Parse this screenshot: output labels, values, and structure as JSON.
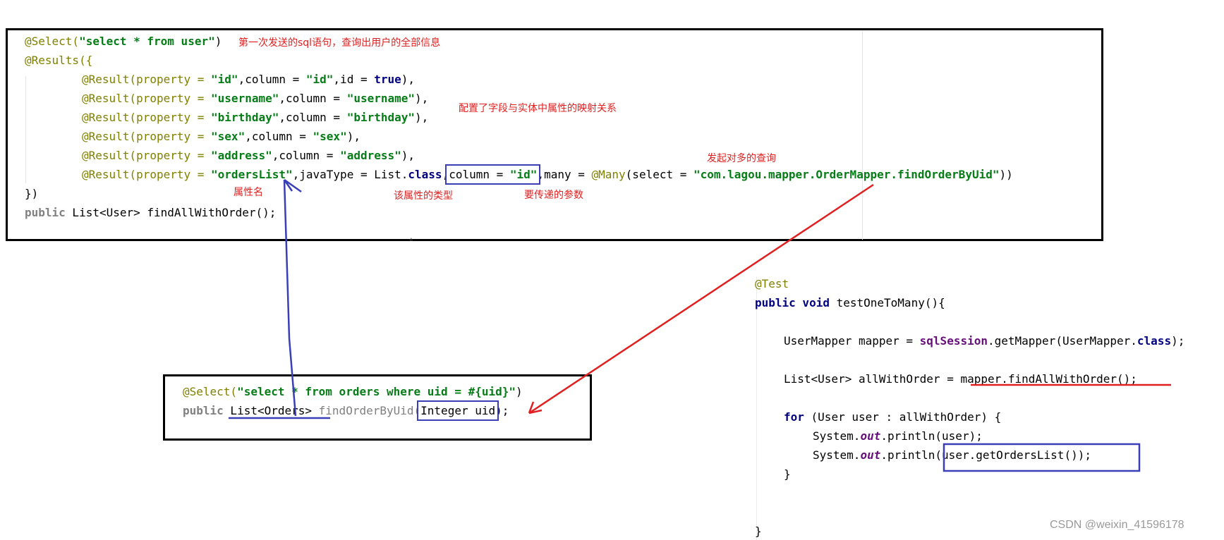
{
  "top_panel": {
    "lines": [
      [
        "@Select(",
        "\"select * from user\"",
        ")"
      ],
      [
        "@Results({"
      ],
      [
        "@Result(property = ",
        "\"id\"",
        ",column = ",
        "\"id\"",
        ",id = ",
        "true",
        "),"
      ],
      [
        "@Result(property = ",
        "\"username\"",
        ",column = ",
        "\"username\"",
        "),"
      ],
      [
        "@Result(property = ",
        "\"birthday\"",
        ",column = ",
        "\"birthday\"",
        "),"
      ],
      [
        "@Result(property = ",
        "\"sex\"",
        ",column = ",
        "\"sex\"",
        "),"
      ],
      [
        "@Result(property = ",
        "\"address\"",
        ",column = ",
        "\"address\"",
        "),"
      ],
      [
        "@Result(property = ",
        "\"ordersList\"",
        ",javaType = List.",
        "class",
        ",",
        "column = ",
        "\"id\"",
        ",many = ",
        "@Many",
        "(select = ",
        "\"com.lagou.mapper.OrderMapper.findOrderByUid\"",
        "))"
      ],
      [
        "})"
      ],
      [
        "public",
        " List<User> findAllWithOrder();"
      ]
    ]
  },
  "notes": {
    "first_sql": "第一次发送的sql语句，查询出用户的全部信息",
    "mapping": "配置了字段与实体中属性的映射关系",
    "one_to_many": "发起对多的查询",
    "property_name": "属性名",
    "property_type": "该属性的类型",
    "param": "要传递的参数"
  },
  "bottom_panel": {
    "lines": [
      [
        "@Select(",
        "\"select * from orders where uid = #{uid}\"",
        ")"
      ],
      [
        "public",
        " List<Orders> ",
        "findOrderByUid(",
        "Integer uid",
        ");"
      ]
    ]
  },
  "test_panel": {
    "lines": [
      [
        "@Test"
      ],
      [
        "public void",
        " testOneToMany(){"
      ],
      [
        "UserMapper mapper = ",
        "sqlSession",
        ".getMapper(UserMapper.",
        "class",
        ");"
      ],
      [
        "List<User> allWithOrder = ",
        "mapper.findAllWithOrder();"
      ],
      [
        "for",
        " (User user : allWithOrder) {"
      ],
      [
        "System.",
        "out",
        ".println(user);"
      ],
      [
        "System.",
        "out",
        ".println(",
        "user.getOrdersList());"
      ],
      [
        "}"
      ],
      [
        "}"
      ]
    ]
  },
  "watermark": "CSDN @weixin_41596178",
  "colors": {
    "annotation": "#808000",
    "string": "#067d17",
    "keyword": "#000080",
    "field": "#660e7a",
    "note_red": "#e02020",
    "arrow_blue": "#3a3fb8",
    "arrow_red": "#e02020"
  }
}
